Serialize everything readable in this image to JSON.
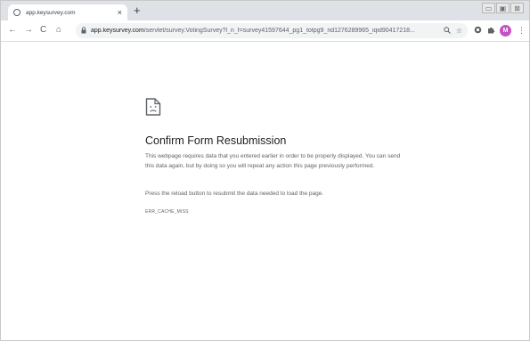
{
  "tab": {
    "title": "app.keysurvey.com",
    "close_glyph": "×",
    "new_tab_glyph": "+"
  },
  "window_controls": {
    "minimize": "▭",
    "maximize": "▣",
    "close": "⊠"
  },
  "toolbar": {
    "back_glyph": "←",
    "forward_glyph": "→",
    "reload_glyph": "C",
    "home_glyph": "⌂",
    "url_host": "app.keysurvey.com",
    "url_path": "/servlet/survey.VotingSurvey?l_n_f=survey41597644_pg1_totpg9_rid1276289965_iqid90417218...",
    "avatar_letter": "M"
  },
  "error": {
    "title": "Confirm Form Resubmission",
    "description": "This webpage requires data that you entered earlier in order to be properly displayed. You can send this data again, but by doing so you will repeat any action this page previously performed.",
    "hint": "Press the reload button to resubmit the data needed to load the page.",
    "code": "ERR_CACHE_MISS"
  },
  "colors": {
    "tab_strip": "#dee1e6",
    "omnibox": "#f1f3f4",
    "avatar": "#c353c3",
    "title_text": "#202124",
    "body_text": "#5f6368"
  }
}
